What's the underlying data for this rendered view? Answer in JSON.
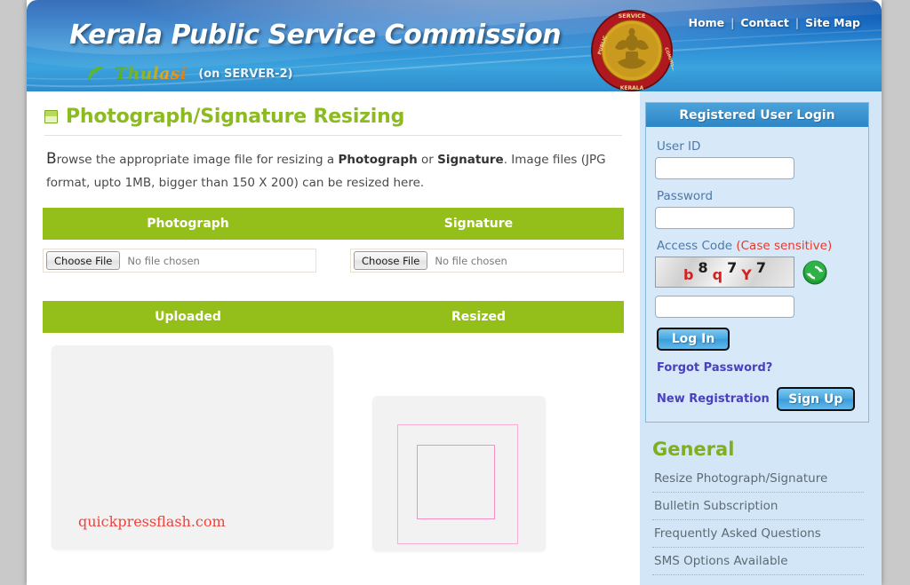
{
  "header": {
    "site_title": "Kerala Public Service Commission",
    "brand_word": "Thulasi",
    "server_note": "(on SERVER-2)",
    "leaf_icon": "leaf-icon",
    "emblem_icon": "kpsc-emblem-icon",
    "emblem_outer_text": "PUBLIC SERVICE COMMISSION",
    "emblem_bottom_text": "KERALA",
    "nav": {
      "home": "Home",
      "sep1": "|",
      "contact": "Contact",
      "sep2": "|",
      "site_map": "Site Map"
    }
  },
  "main": {
    "heading": "Photograph/Signature Resizing",
    "heading_icon": "green-square-icon",
    "intro_dropcap": "B",
    "intro_part1": "rowse the appropriate image file for resizing a ",
    "intro_bold1": "Photograph",
    "intro_part2": " or ",
    "intro_bold2": "Signature",
    "intro_part3": ". Image files (JPG format, upto 1MB, bigger than 150 X 200) can be resized here.",
    "table1": {
      "col1": "Photograph",
      "col2": "Signature"
    },
    "file_photo": {
      "button_label": "Choose File",
      "status": "No file chosen"
    },
    "file_signature": {
      "button_label": "Choose File",
      "status": "No file chosen"
    },
    "table2": {
      "col1": "Uploaded",
      "col2": "Resized"
    },
    "uploaded_watermark": "quickpressflash.com"
  },
  "sidebar": {
    "login": {
      "title": "Registered User Login",
      "userid_label": "User ID",
      "userid_value": "",
      "password_label": "Password",
      "password_value": "",
      "access_code_label": "Access Code ",
      "access_code_warning": "(Case sensitive)",
      "captcha_chars": [
        "b",
        "8",
        "q",
        "7",
        "Y",
        "7"
      ],
      "captcha_colors": [
        "red",
        "black",
        "red",
        "black",
        "red",
        "black"
      ],
      "captcha_value": "",
      "refresh_icon": "refresh-icon",
      "login_button": "Log In",
      "forgot_link": "Forgot Password?",
      "new_registration_label": "New Registration",
      "signup_button": "Sign Up"
    },
    "general": {
      "title": "General",
      "items": [
        {
          "label": "Resize Photograph/Signature"
        },
        {
          "label": "Bulletin Subscription"
        },
        {
          "label": "Frequently Asked Questions"
        },
        {
          "label": "SMS Options Available"
        }
      ]
    }
  },
  "colors": {
    "header_blue": "#2e8fd6",
    "accent_green": "#94be1a",
    "heading_green": "#8cbb20",
    "sidebar_blue": "#d3e6f7",
    "panel_title_blue": "#3a92cf",
    "link_purple": "#4a3fbf",
    "warning_red": "#e8392b",
    "watermark_red": "#f4403a",
    "crop_pink": "#f58fc4",
    "page_background": "#c9c9c9"
  }
}
